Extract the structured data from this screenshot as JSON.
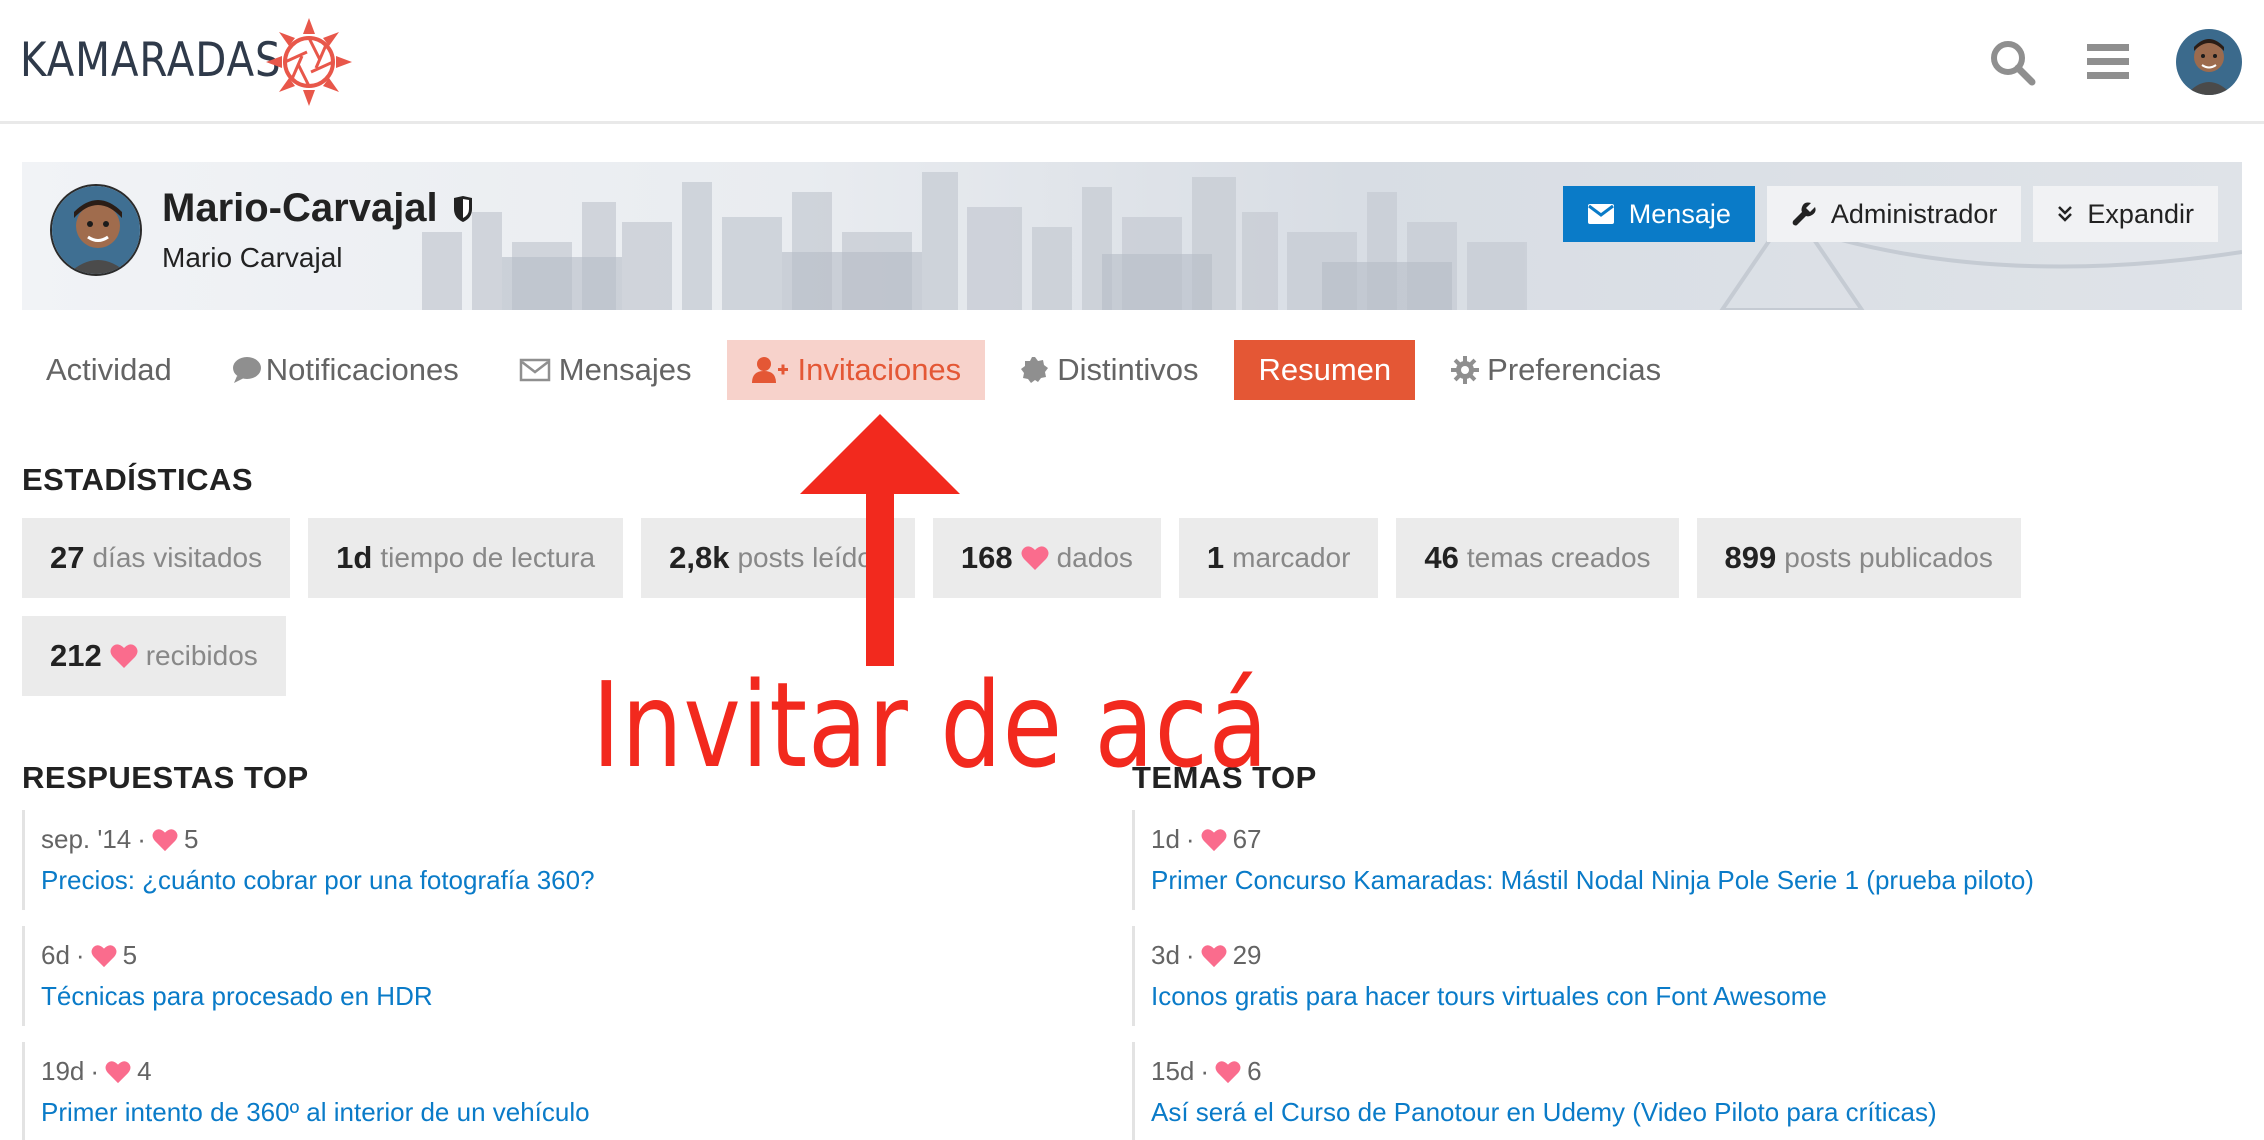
{
  "header": {
    "logo_text": "KAMARADAS",
    "icons": [
      "search-icon",
      "hamburger-menu-icon",
      "user-avatar"
    ]
  },
  "profile": {
    "username": "Mario-Carvajal",
    "full_name": "Mario Carvajal",
    "actions": {
      "message": "Mensaje",
      "admin": "Administrador",
      "expand": "Expandir"
    }
  },
  "tabs": [
    {
      "label": "Actividad",
      "icon": ""
    },
    {
      "label": "Notificaciones",
      "icon": "comment-icon"
    },
    {
      "label": "Mensajes",
      "icon": "envelope-icon"
    },
    {
      "label": "Invitaciones",
      "icon": "user-plus-icon",
      "highlighted": true
    },
    {
      "label": "Distintivos",
      "icon": "badge-icon"
    },
    {
      "label": "Resumen",
      "icon": "",
      "active": true
    },
    {
      "label": "Preferencias",
      "icon": "gear-icon"
    }
  ],
  "stats": {
    "title": "ESTADÍSTICAS",
    "items": [
      {
        "value": "27",
        "label": "días visitados"
      },
      {
        "value": "1d",
        "label": "tiempo de lectura"
      },
      {
        "value": "2,8k",
        "label": "posts leídos"
      },
      {
        "value": "168",
        "label": "dados",
        "heart": true
      },
      {
        "value": "1",
        "label": "marcador"
      },
      {
        "value": "46",
        "label": "temas creados"
      },
      {
        "value": "899",
        "label": "posts publicados"
      },
      {
        "value": "212",
        "label": "recibidos",
        "heart": true
      }
    ]
  },
  "top_replies": {
    "title": "RESPUESTAS TOP",
    "items": [
      {
        "date": "sep. '14",
        "likes": "5",
        "title": "Precios: ¿cuánto cobrar por una fotografía 360?"
      },
      {
        "date": "6d",
        "likes": "5",
        "title": "Técnicas para procesado en HDR"
      },
      {
        "date": "19d",
        "likes": "4",
        "title": "Primer intento de 360º al interior de un vehículo"
      }
    ]
  },
  "top_topics": {
    "title": "TEMAS TOP",
    "items": [
      {
        "date": "1d",
        "likes": "67",
        "title": "Primer Concurso Kamaradas: Mástil Nodal Ninja Pole Serie 1 (prueba piloto)"
      },
      {
        "date": "3d",
        "likes": "29",
        "title": "Iconos gratis para hacer tours virtuales con Font Awesome"
      },
      {
        "date": "15d",
        "likes": "6",
        "title": "Así será el Curso de Panotour en Udemy (Video Piloto para críticas)"
      }
    ]
  },
  "annotation": {
    "text": "Invitar de acá",
    "color": "#f2291e"
  },
  "colors": {
    "primary_blue": "#0a7bc8",
    "accent_orange": "#e45735",
    "invite_highlight": "#f7d2cb",
    "heart_pink": "#fa6c8d"
  }
}
